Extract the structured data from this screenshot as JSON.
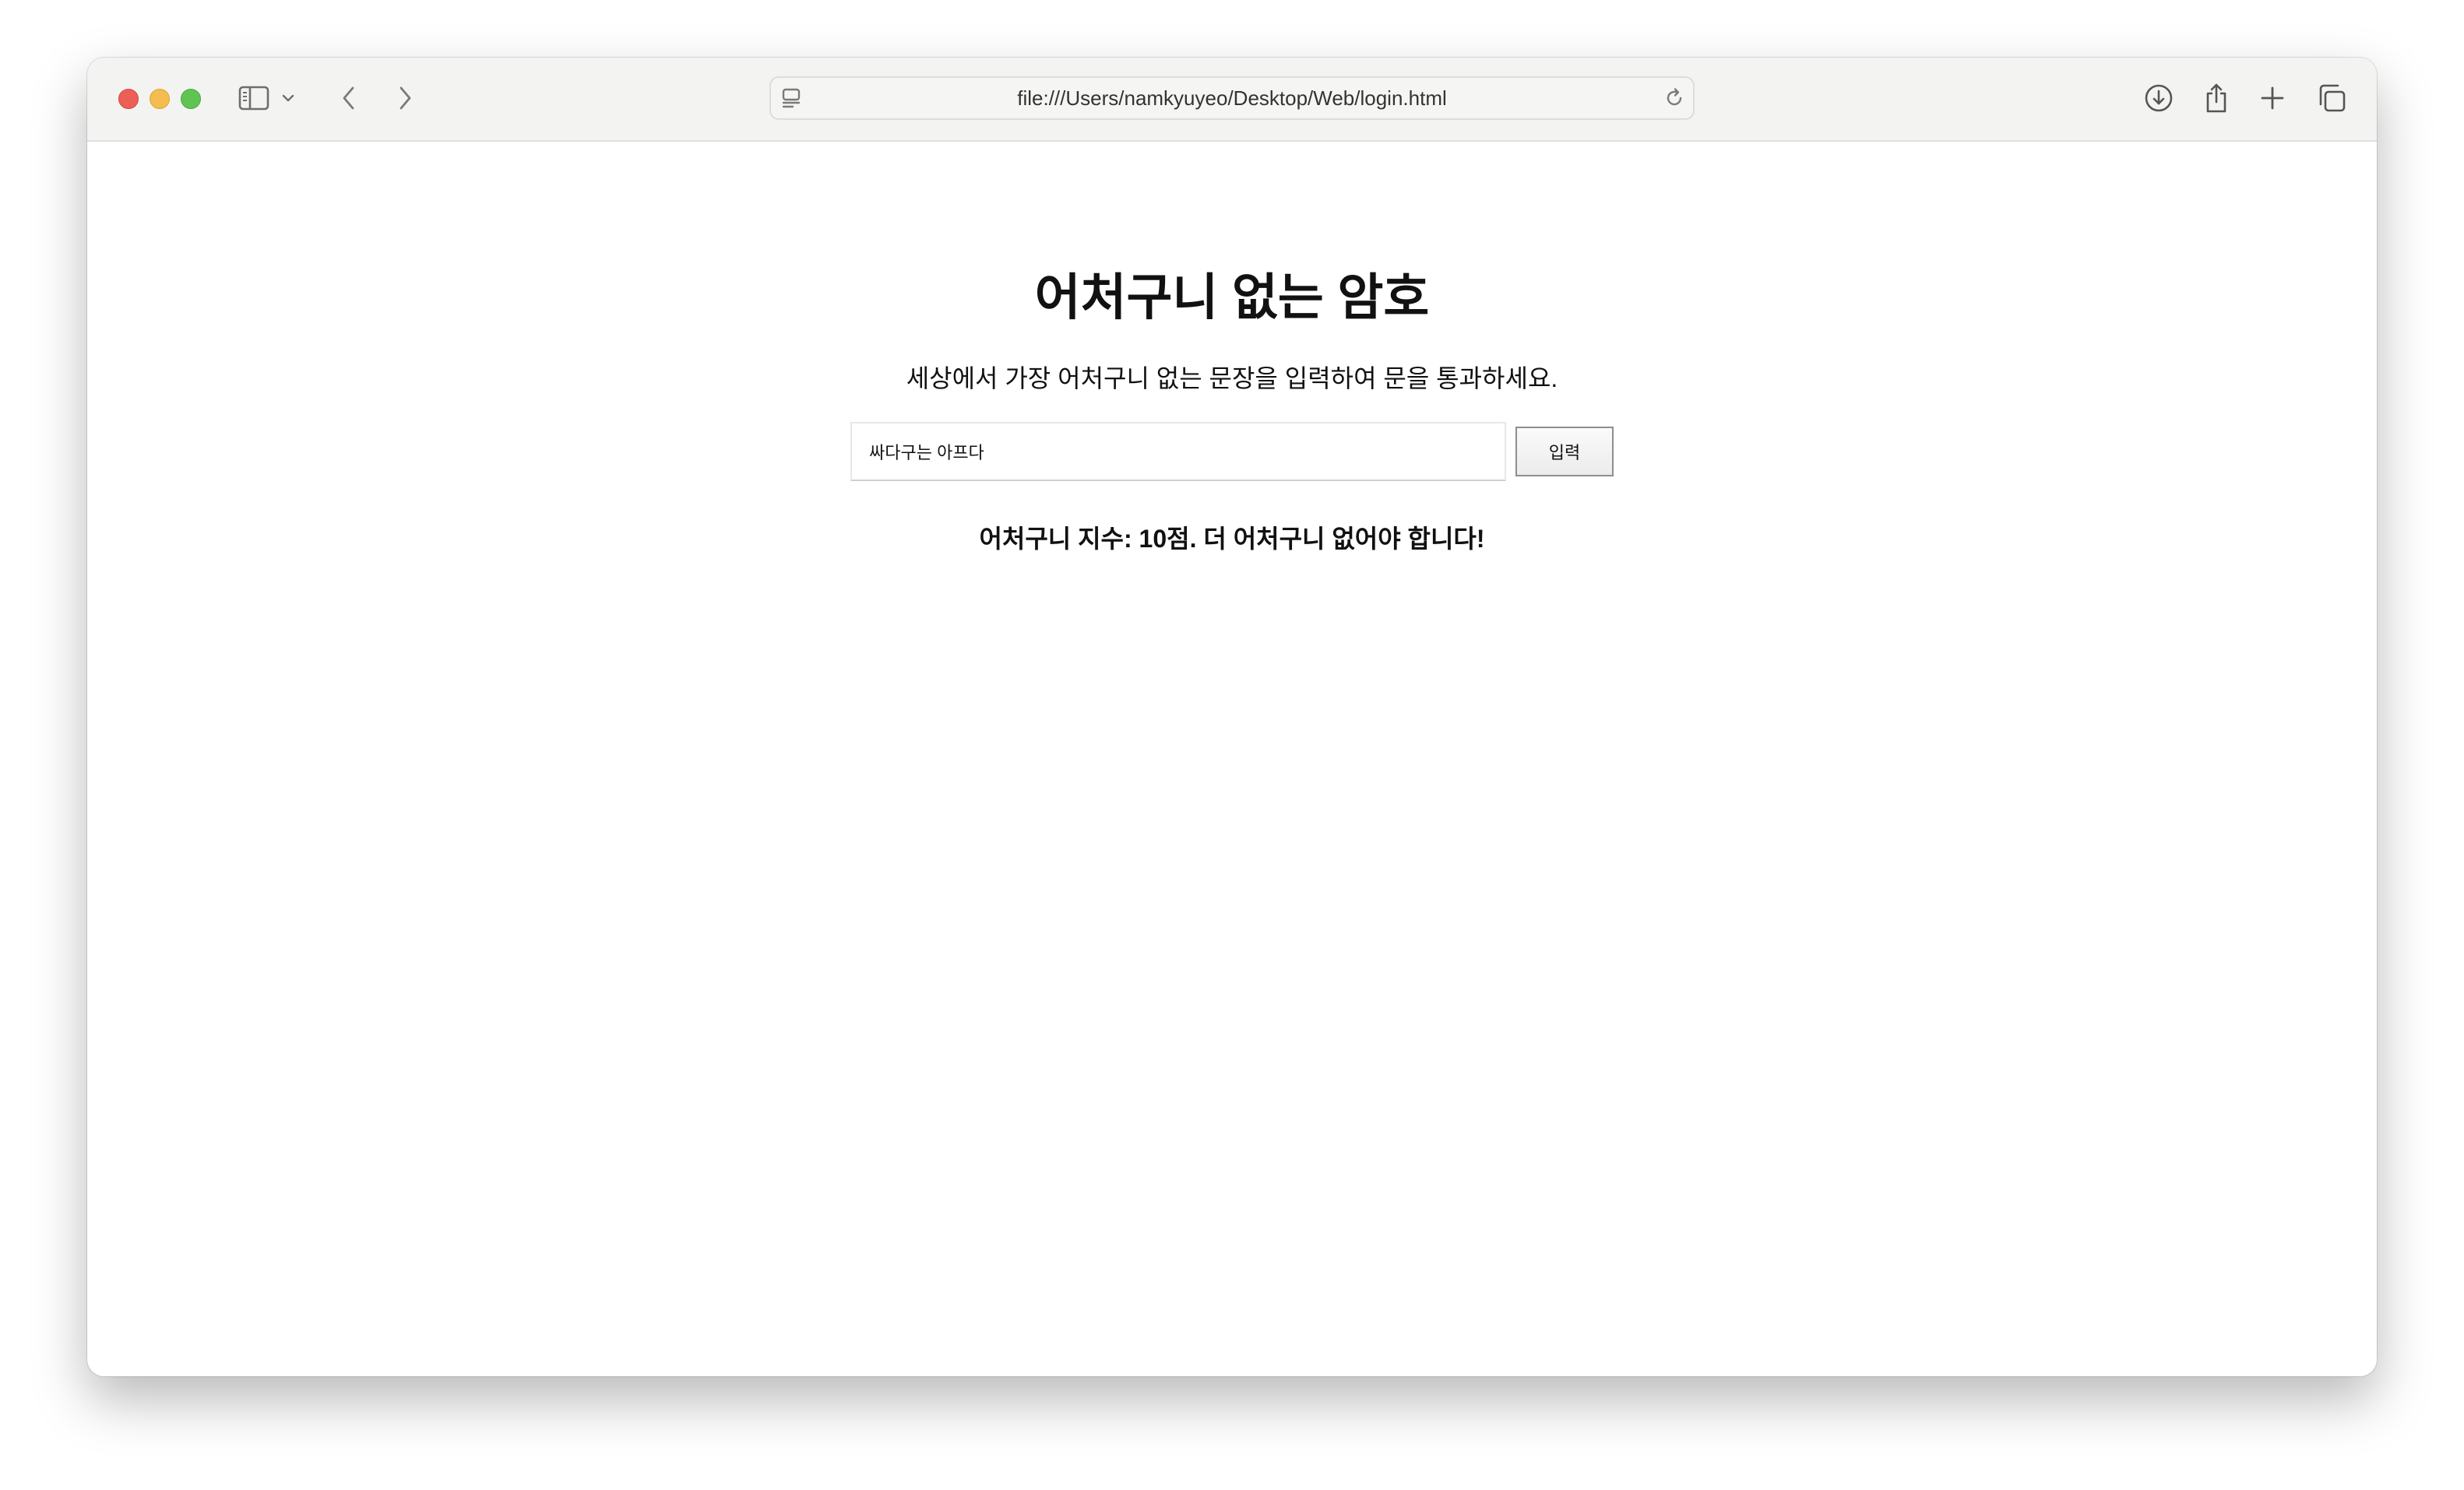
{
  "browser": {
    "url": "file:///Users/namkyuyeo/Desktop/Web/login.html",
    "icons": {
      "close": "close-dot",
      "minimize": "minimize-dot",
      "zoom": "zoom-dot",
      "sidebar": "sidebar-icon",
      "sidebar_menu": "chevron-down-icon",
      "back": "chevron-left-icon",
      "forward": "chevron-right-icon",
      "page_menu": "page-icon",
      "reload": "reload-icon",
      "downloads": "download-icon",
      "share": "share-icon",
      "new_tab": "plus-icon",
      "tabs_overview": "tabs-icon"
    },
    "traffic_light_colors": {
      "close": "#ec5f56",
      "minimize": "#f3bd4f",
      "zoom": "#5fc453"
    }
  },
  "page": {
    "title": "어처구니 없는 암호",
    "subtitle": "세상에서 가장 어처구니 없는 문장을 입력하여 문을 통과하세요.",
    "input_value": "싸다구는 아프다",
    "submit_label": "입력",
    "result": "어처구니 지수: 10점. 더 어처구니 없어야 합니다!"
  }
}
